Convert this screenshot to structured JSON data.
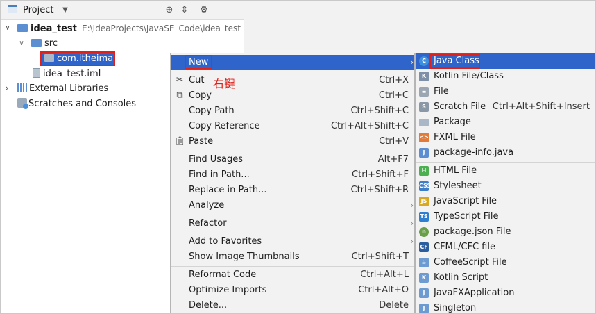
{
  "project_panel": {
    "title": "Project",
    "tree": {
      "root_name": "idea_test",
      "root_path": "E:\\IdeaProjects\\JavaSE_Code\\idea_test",
      "src": "src",
      "package": "com.itheima",
      "iml": "idea_test.iml",
      "external_libraries": "External Libraries",
      "scratches": "Scratches and Consoles"
    }
  },
  "annotation": "右键",
  "context_menu": {
    "new": "New",
    "cut": {
      "label": "Cut",
      "shortcut": "Ctrl+X"
    },
    "copy": {
      "label": "Copy",
      "shortcut": "Ctrl+C"
    },
    "copy_path": {
      "label": "Copy Path",
      "shortcut": "Ctrl+Shift+C"
    },
    "copy_reference": {
      "label": "Copy Reference",
      "shortcut": "Ctrl+Alt+Shift+C"
    },
    "paste": {
      "label": "Paste",
      "shortcut": "Ctrl+V"
    },
    "find_usages": {
      "label": "Find Usages",
      "shortcut": "Alt+F7"
    },
    "find_in_path": {
      "label": "Find in Path...",
      "shortcut": "Ctrl+Shift+F"
    },
    "replace_in_path": {
      "label": "Replace in Path...",
      "shortcut": "Ctrl+Shift+R"
    },
    "analyze": "Analyze",
    "refactor": "Refactor",
    "add_to_favorites": "Add to Favorites",
    "show_image_thumbnails": {
      "label": "Show Image Thumbnails",
      "shortcut": "Ctrl+Shift+T"
    },
    "reformat_code": {
      "label": "Reformat Code",
      "shortcut": "Ctrl+Alt+L"
    },
    "optimize_imports": {
      "label": "Optimize Imports",
      "shortcut": "Ctrl+Alt+O"
    },
    "delete": {
      "label": "Delete...",
      "shortcut": "Delete"
    }
  },
  "new_submenu": {
    "java_class": "Java Class",
    "kotlin_file_class": "Kotlin File/Class",
    "file": "File",
    "scratch_file": {
      "label": "Scratch File",
      "shortcut": "Ctrl+Alt+Shift+Insert"
    },
    "package": "Package",
    "fxml_file": "FXML File",
    "package_info": "package-info.java",
    "html_file": "HTML File",
    "stylesheet": "Stylesheet",
    "javascript_file": "JavaScript File",
    "typescript_file": "TypeScript File",
    "package_json": "package.json File",
    "cfml_file": "CFML/CFC file",
    "coffeescript_file": "CoffeeScript File",
    "kotlin_script": "Kotlin Script",
    "javafx_app": "JavaFXApplication",
    "singleton": "Singleton"
  },
  "colors": {
    "selection": "#2f65ca",
    "highlight_box": "#e0201a",
    "menu_bg": "#f2f2f2"
  }
}
